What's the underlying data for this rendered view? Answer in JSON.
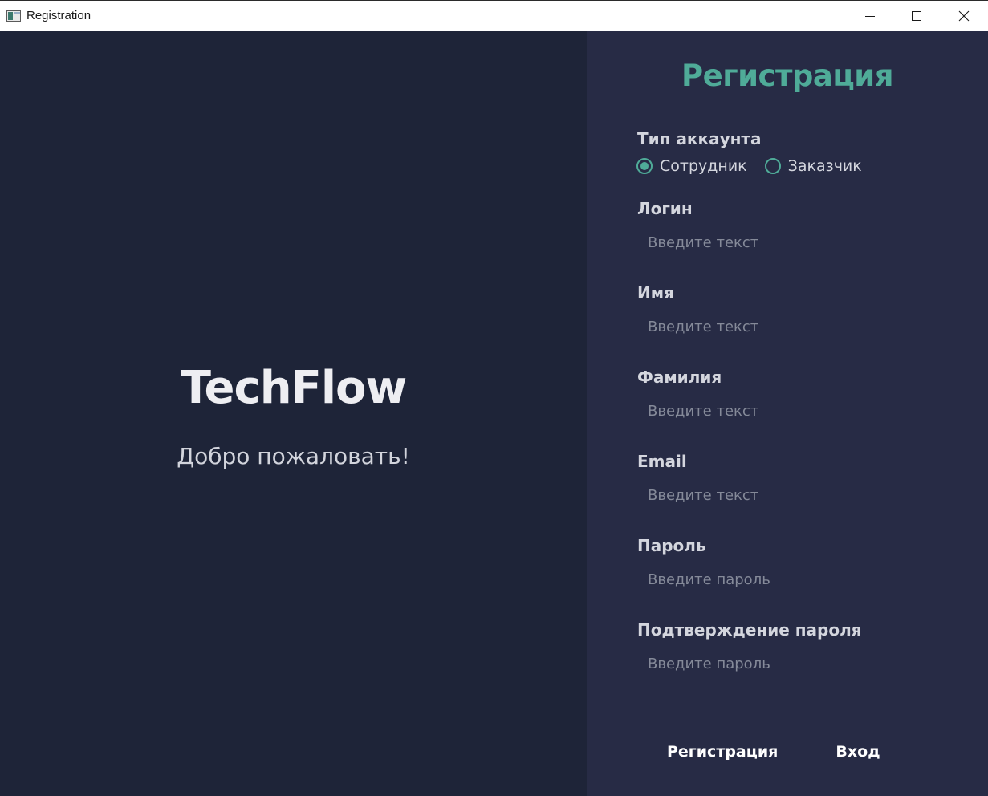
{
  "window": {
    "title": "Registration"
  },
  "left": {
    "brand": "TechFlow",
    "welcome": "Добро пожаловать!"
  },
  "form": {
    "title": "Регистрация",
    "account_type": {
      "label": "Тип аккаунта",
      "options": [
        {
          "label": "Сотрудник",
          "selected": true
        },
        {
          "label": "Заказчик",
          "selected": false
        }
      ]
    },
    "fields": [
      {
        "label": "Логин",
        "placeholder": "Введите текст",
        "value": ""
      },
      {
        "label": "Имя",
        "placeholder": "Введите текст",
        "value": ""
      },
      {
        "label": "Фамилия",
        "placeholder": "Введите текст",
        "value": ""
      },
      {
        "label": "Email",
        "placeholder": "Введите текст",
        "value": ""
      },
      {
        "label": "Пароль",
        "placeholder": "Введите пароль",
        "value": ""
      },
      {
        "label": "Подтверждение пароля",
        "placeholder": "Введите пароль",
        "value": ""
      }
    ],
    "buttons": {
      "register_label": "Регистрация",
      "login_label": "Вход"
    }
  },
  "colors": {
    "left_bg": "#1e2438",
    "right_bg": "#272b45",
    "accent": "#4fab98",
    "label_text": "#d4d6de",
    "placeholder_text": "#858a99"
  },
  "icons": {
    "app": "app-window-icon",
    "minimize": "minimize-icon",
    "maximize": "maximize-icon",
    "close": "close-icon"
  }
}
